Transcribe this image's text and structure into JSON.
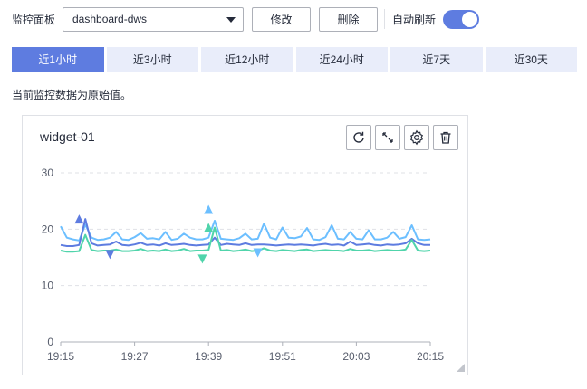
{
  "toolbar": {
    "panel_label": "监控面板",
    "panel_select": "dashboard-dws",
    "modify_label": "修改",
    "delete_label": "删除",
    "auto_refresh_label": "自动刷新",
    "auto_refresh_on": true
  },
  "tabs": [
    {
      "label": "近1小时",
      "active": true
    },
    {
      "label": "近3小时",
      "active": false
    },
    {
      "label": "近12小时",
      "active": false
    },
    {
      "label": "近24小时",
      "active": false
    },
    {
      "label": "近7天",
      "active": false
    },
    {
      "label": "近30天",
      "active": false
    }
  ],
  "hint": "当前监控数据为原始值。",
  "widget": {
    "title": "widget-01",
    "actions": [
      "refresh-icon",
      "expand-icon",
      "settings-icon",
      "trash-icon"
    ]
  },
  "chart_data": {
    "type": "line",
    "x": [
      "19:15",
      "19:16",
      "19:17",
      "19:18",
      "19:19",
      "19:20",
      "19:21",
      "19:22",
      "19:23",
      "19:24",
      "19:25",
      "19:26",
      "19:27",
      "19:28",
      "19:29",
      "19:30",
      "19:31",
      "19:32",
      "19:33",
      "19:34",
      "19:35",
      "19:36",
      "19:37",
      "19:38",
      "19:39",
      "19:40",
      "19:41",
      "19:42",
      "19:43",
      "19:44",
      "19:45",
      "19:46",
      "19:47",
      "19:48",
      "19:49",
      "19:50",
      "19:51",
      "19:52",
      "19:53",
      "19:54",
      "19:55",
      "19:56",
      "19:57",
      "19:58",
      "19:59",
      "20:00",
      "20:01",
      "20:02",
      "20:03",
      "20:04",
      "20:05",
      "20:06",
      "20:07",
      "20:08",
      "20:09",
      "20:10",
      "20:11",
      "20:12",
      "20:13",
      "20:14",
      "20:15"
    ],
    "xticks": [
      "19:15",
      "19:27",
      "19:39",
      "19:51",
      "20:03",
      "20:15"
    ],
    "yticks": [
      0,
      10,
      20,
      30
    ],
    "ylim": [
      0,
      30
    ],
    "grid": true,
    "series": [
      {
        "color": "#6cbfff",
        "values": [
          20.5,
          18.5,
          18.2,
          18,
          20.8,
          18.5,
          18.1,
          18.2,
          18.5,
          19.5,
          18.2,
          18.1,
          18.6,
          19.3,
          18.3,
          18.4,
          18.2,
          19.5,
          18.1,
          18.3,
          19.2,
          18.5,
          18.2,
          18.2,
          18.5,
          21.5,
          18.3,
          18.2,
          18.1,
          18.4,
          19.2,
          18.2,
          18.3,
          21,
          18.5,
          18.2,
          20.3,
          18.5,
          18.4,
          18.7,
          20.2,
          18.2,
          18.1,
          18.6,
          20.7,
          18.3,
          18.2,
          19.5,
          18.3,
          18.2,
          19.8,
          18.2,
          18.2,
          18.5,
          19.5,
          18.3,
          18.6,
          20.7,
          18.2,
          18.1,
          18.2
        ]
      },
      {
        "color": "#5e7ce0",
        "values": [
          17.2,
          17,
          17,
          17.2,
          21.8,
          17.5,
          17.1,
          17.2,
          17.3,
          17.8,
          17.2,
          17.1,
          17.3,
          17.6,
          17.2,
          17.3,
          17.1,
          17.5,
          17.2,
          17.3,
          17.4,
          17.2,
          17.1,
          17.2,
          17.3,
          18.5,
          17.2,
          17.4,
          17.3,
          17.2,
          17.5,
          17.2,
          17.3,
          17.3,
          17.2,
          17.1,
          17.2,
          17.3,
          17.2,
          17.3,
          17.2,
          17.1,
          17.3,
          17.4,
          17.2,
          17.3,
          17.1,
          17.8,
          17.2,
          17.3,
          17.4,
          17.2,
          17.1,
          17.3,
          17.2,
          17.3,
          17.5,
          18.3,
          17.5,
          17.2,
          17.2
        ]
      },
      {
        "color": "#50d4ab",
        "values": [
          16.2,
          16,
          16,
          16.1,
          19,
          16.3,
          16.1,
          16.2,
          16.2,
          16.4,
          16.1,
          16.1,
          16.2,
          16.5,
          16.1,
          16.2,
          16.1,
          16.4,
          16.1,
          16.2,
          16.5,
          16.1,
          16.2,
          16.2,
          16.3,
          20.3,
          16.2,
          16.3,
          16.1,
          16.2,
          16.4,
          16.1,
          16.2,
          16.6,
          16.2,
          16.1,
          16.3,
          16.2,
          16.1,
          16.3,
          16.4,
          16.1,
          16.2,
          16.3,
          16.2,
          16.2,
          16.1,
          16.5,
          16.2,
          16.2,
          16.3,
          16.1,
          16.2,
          16.3,
          16.2,
          16.2,
          16.4,
          18.1,
          16.2,
          16.1,
          16.2
        ]
      }
    ],
    "markers": [
      {
        "x": "19:18",
        "y": 21.8,
        "dir": "up",
        "color": "#5e7ce0"
      },
      {
        "x": "19:23",
        "y": 15.5,
        "dir": "down",
        "color": "#5e7ce0"
      },
      {
        "x": "19:39",
        "y": 23.5,
        "dir": "up",
        "color": "#6cbfff"
      },
      {
        "x": "19:39",
        "y": 20.3,
        "dir": "up",
        "color": "#50d4ab"
      },
      {
        "x": "19:38",
        "y": 14.7,
        "dir": "down",
        "color": "#50d4ab"
      },
      {
        "x": "19:47",
        "y": 15.8,
        "dir": "down",
        "color": "#6cbfff"
      }
    ]
  }
}
